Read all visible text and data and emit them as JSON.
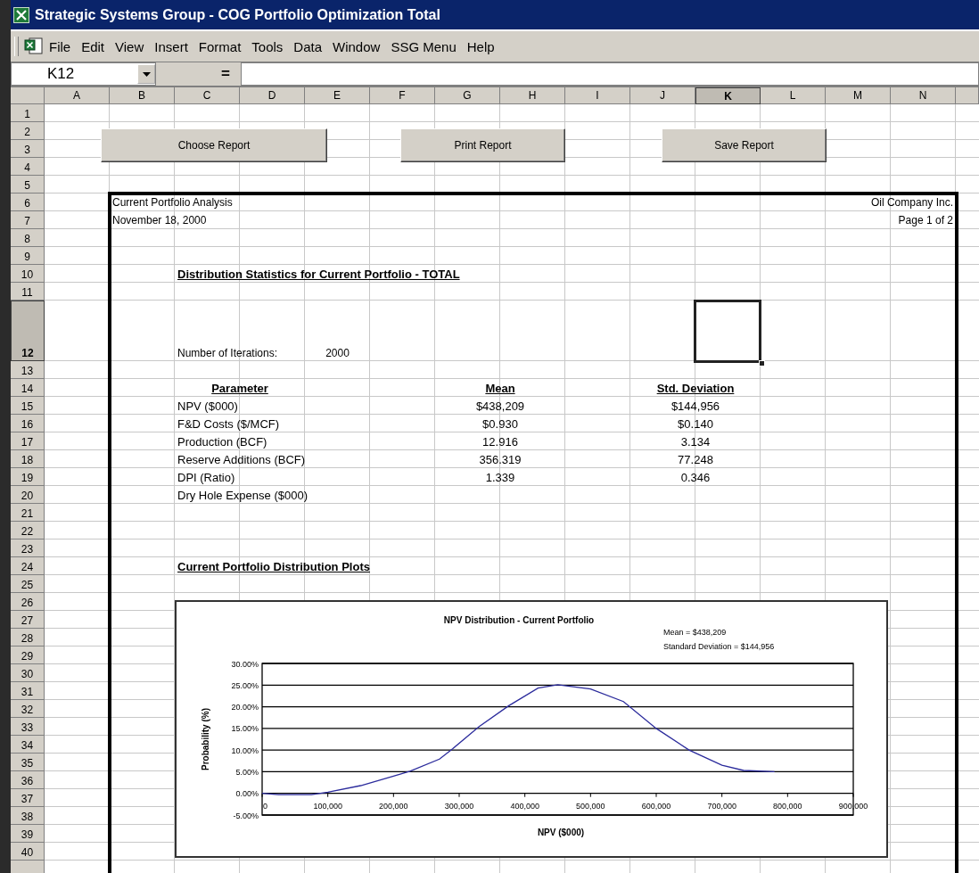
{
  "window": {
    "title": "Strategic Systems Group - COG Portfolio Optimization Total"
  },
  "menu_bar": {
    "items": [
      {
        "label": "File"
      },
      {
        "label": "Edit"
      },
      {
        "label": "View"
      },
      {
        "label": "Insert"
      },
      {
        "label": "Format"
      },
      {
        "label": "Tools"
      },
      {
        "label": "Data"
      },
      {
        "label": "Window"
      },
      {
        "label": "SSG Menu"
      },
      {
        "label": "Help"
      }
    ]
  },
  "formula_bar": {
    "name_box": "K12",
    "equals": "="
  },
  "sheet": {
    "columns": [
      {
        "label": "A",
        "selected": false
      },
      {
        "label": "B",
        "selected": false
      },
      {
        "label": "C",
        "selected": false
      },
      {
        "label": "D",
        "selected": false
      },
      {
        "label": "E",
        "selected": false
      },
      {
        "label": "F",
        "selected": false
      },
      {
        "label": "G",
        "selected": false
      },
      {
        "label": "H",
        "selected": false
      },
      {
        "label": "I",
        "selected": false
      },
      {
        "label": "J",
        "selected": false
      },
      {
        "label": "K",
        "selected": true
      },
      {
        "label": "L",
        "selected": false
      },
      {
        "label": "M",
        "selected": false
      },
      {
        "label": "N",
        "selected": false
      }
    ],
    "rows": [
      {
        "label": "1",
        "selected": false,
        "tall": false
      },
      {
        "label": "2",
        "selected": false,
        "tall": false
      },
      {
        "label": "3",
        "selected": false,
        "tall": false
      },
      {
        "label": "4",
        "selected": false,
        "tall": false
      },
      {
        "label": "5",
        "selected": false,
        "tall": false
      },
      {
        "label": "6",
        "selected": false,
        "tall": false
      },
      {
        "label": "7",
        "selected": false,
        "tall": false
      },
      {
        "label": "8",
        "selected": false,
        "tall": false
      },
      {
        "label": "9",
        "selected": false,
        "tall": false
      },
      {
        "label": "10",
        "selected": false,
        "tall": false
      },
      {
        "label": "11",
        "selected": false,
        "tall": false
      },
      {
        "label": "12",
        "selected": true,
        "tall": true
      },
      {
        "label": "13",
        "selected": false,
        "tall": false
      },
      {
        "label": "14",
        "selected": false,
        "tall": false
      },
      {
        "label": "15",
        "selected": false,
        "tall": false
      },
      {
        "label": "16",
        "selected": false,
        "tall": false
      },
      {
        "label": "17",
        "selected": false,
        "tall": false
      },
      {
        "label": "18",
        "selected": false,
        "tall": false
      },
      {
        "label": "19",
        "selected": false,
        "tall": false
      },
      {
        "label": "20",
        "selected": false,
        "tall": false
      },
      {
        "label": "21",
        "selected": false,
        "tall": false
      },
      {
        "label": "22",
        "selected": false,
        "tall": false
      },
      {
        "label": "23",
        "selected": false,
        "tall": false
      },
      {
        "label": "24",
        "selected": false,
        "tall": false
      },
      {
        "label": "25",
        "selected": false,
        "tall": false
      },
      {
        "label": "26",
        "selected": false,
        "tall": false
      },
      {
        "label": "27",
        "selected": false,
        "tall": false
      },
      {
        "label": "28",
        "selected": false,
        "tall": false
      },
      {
        "label": "29",
        "selected": false,
        "tall": false
      },
      {
        "label": "30",
        "selected": false,
        "tall": false
      },
      {
        "label": "31",
        "selected": false,
        "tall": false
      },
      {
        "label": "32",
        "selected": false,
        "tall": false
      },
      {
        "label": "33",
        "selected": false,
        "tall": false
      },
      {
        "label": "34",
        "selected": false,
        "tall": false
      },
      {
        "label": "35",
        "selected": false,
        "tall": false
      },
      {
        "label": "36",
        "selected": false,
        "tall": false
      },
      {
        "label": "37",
        "selected": false,
        "tall": false
      },
      {
        "label": "38",
        "selected": false,
        "tall": false
      },
      {
        "label": "39",
        "selected": false,
        "tall": false
      },
      {
        "label": "40",
        "selected": false,
        "tall": false
      }
    ],
    "buttons": [
      "Choose Report",
      "Print Report",
      "Save Report"
    ],
    "report": {
      "header_left": [
        "Current Portfolio Analysis",
        "November 18, 2000"
      ],
      "header_right": [
        "Oil Company Inc.",
        "Page 1 of 2"
      ],
      "section_title": "Distribution Statistics for Current Portfolio - TOTAL",
      "iterations": {
        "label": "Number of Iterations:",
        "value": "2000"
      },
      "table": {
        "columns": [
          "Parameter",
          "Mean",
          "Std. Deviation"
        ],
        "rows": [
          {
            "parameter": "NPV  ($000)",
            "mean": "$438,209",
            "std_dev": "$144,956"
          },
          {
            "parameter": "F&D Costs  ($/MCF)",
            "mean": "$0.930",
            "std_dev": "$0.140"
          },
          {
            "parameter": "Production  (BCF)",
            "mean": "12.916",
            "std_dev": "3.134"
          },
          {
            "parameter": "Reserve Additions  (BCF)",
            "mean": "356.319",
            "std_dev": "77.248"
          },
          {
            "parameter": "DPI  (Ratio)",
            "mean": "1.339",
            "std_dev": "0.346"
          },
          {
            "parameter": "Dry Hole Expense  ($000)"
          }
        ]
      },
      "plots_title": "Current Portfolio Distribution Plots",
      "chart_data": {
        "type": "line",
        "title": "NPV Distribution - Current Portfolio",
        "xlabel": "NPV ($000)",
        "ylabel": "Probability (%)",
        "x": [
          0,
          25000,
          50000,
          75000,
          100000,
          150000,
          200000,
          225000,
          270000,
          290000,
          330000,
          375000,
          420000,
          450000,
          500000,
          550000,
          600000,
          650000,
          700000,
          733000,
          780000
        ],
        "series": [
          {
            "color": "#2b2b9c",
            "values": [
              0,
              -0.3,
              -0.3,
              -0.3,
              0.3,
              1.8,
              4.0,
              5.1,
              7.9,
              10.3,
              15.4,
              20.2,
              24.3,
              25.1,
              24.1,
              21.2,
              15.0,
              10.0,
              6.5,
              5.3,
              5.0
            ]
          }
        ],
        "xlim": [
          0,
          900000
        ],
        "ylim": [
          -5,
          30
        ],
        "grid": true,
        "xticks": [
          {
            "value": 0,
            "label": "0"
          },
          {
            "value": 100000,
            "label": "100,000"
          },
          {
            "value": 200000,
            "label": "200,000"
          },
          {
            "value": 300000,
            "label": "300,000"
          },
          {
            "value": 400000,
            "label": "400,000"
          },
          {
            "value": 500000,
            "label": "500,000"
          },
          {
            "value": 600000,
            "label": "600,000"
          },
          {
            "value": 700000,
            "label": "700,000"
          },
          {
            "value": 800000,
            "label": "800,000"
          },
          {
            "value": 900000,
            "label": "900,000"
          }
        ],
        "yticks": [
          {
            "value": -5,
            "label": "-5.00%"
          },
          {
            "value": 0,
            "label": "0.00%"
          },
          {
            "value": 5,
            "label": "5.00%"
          },
          {
            "value": 10,
            "label": "10.00%"
          },
          {
            "value": 15,
            "label": "15.00%"
          },
          {
            "value": 20,
            "label": "20.00%"
          },
          {
            "value": 25,
            "label": "25.00%"
          },
          {
            "value": 30,
            "label": "30.00%"
          }
        ],
        "annotations": [
          "Mean = $438,209",
          "Standard Deviation = $144,956"
        ]
      }
    }
  }
}
